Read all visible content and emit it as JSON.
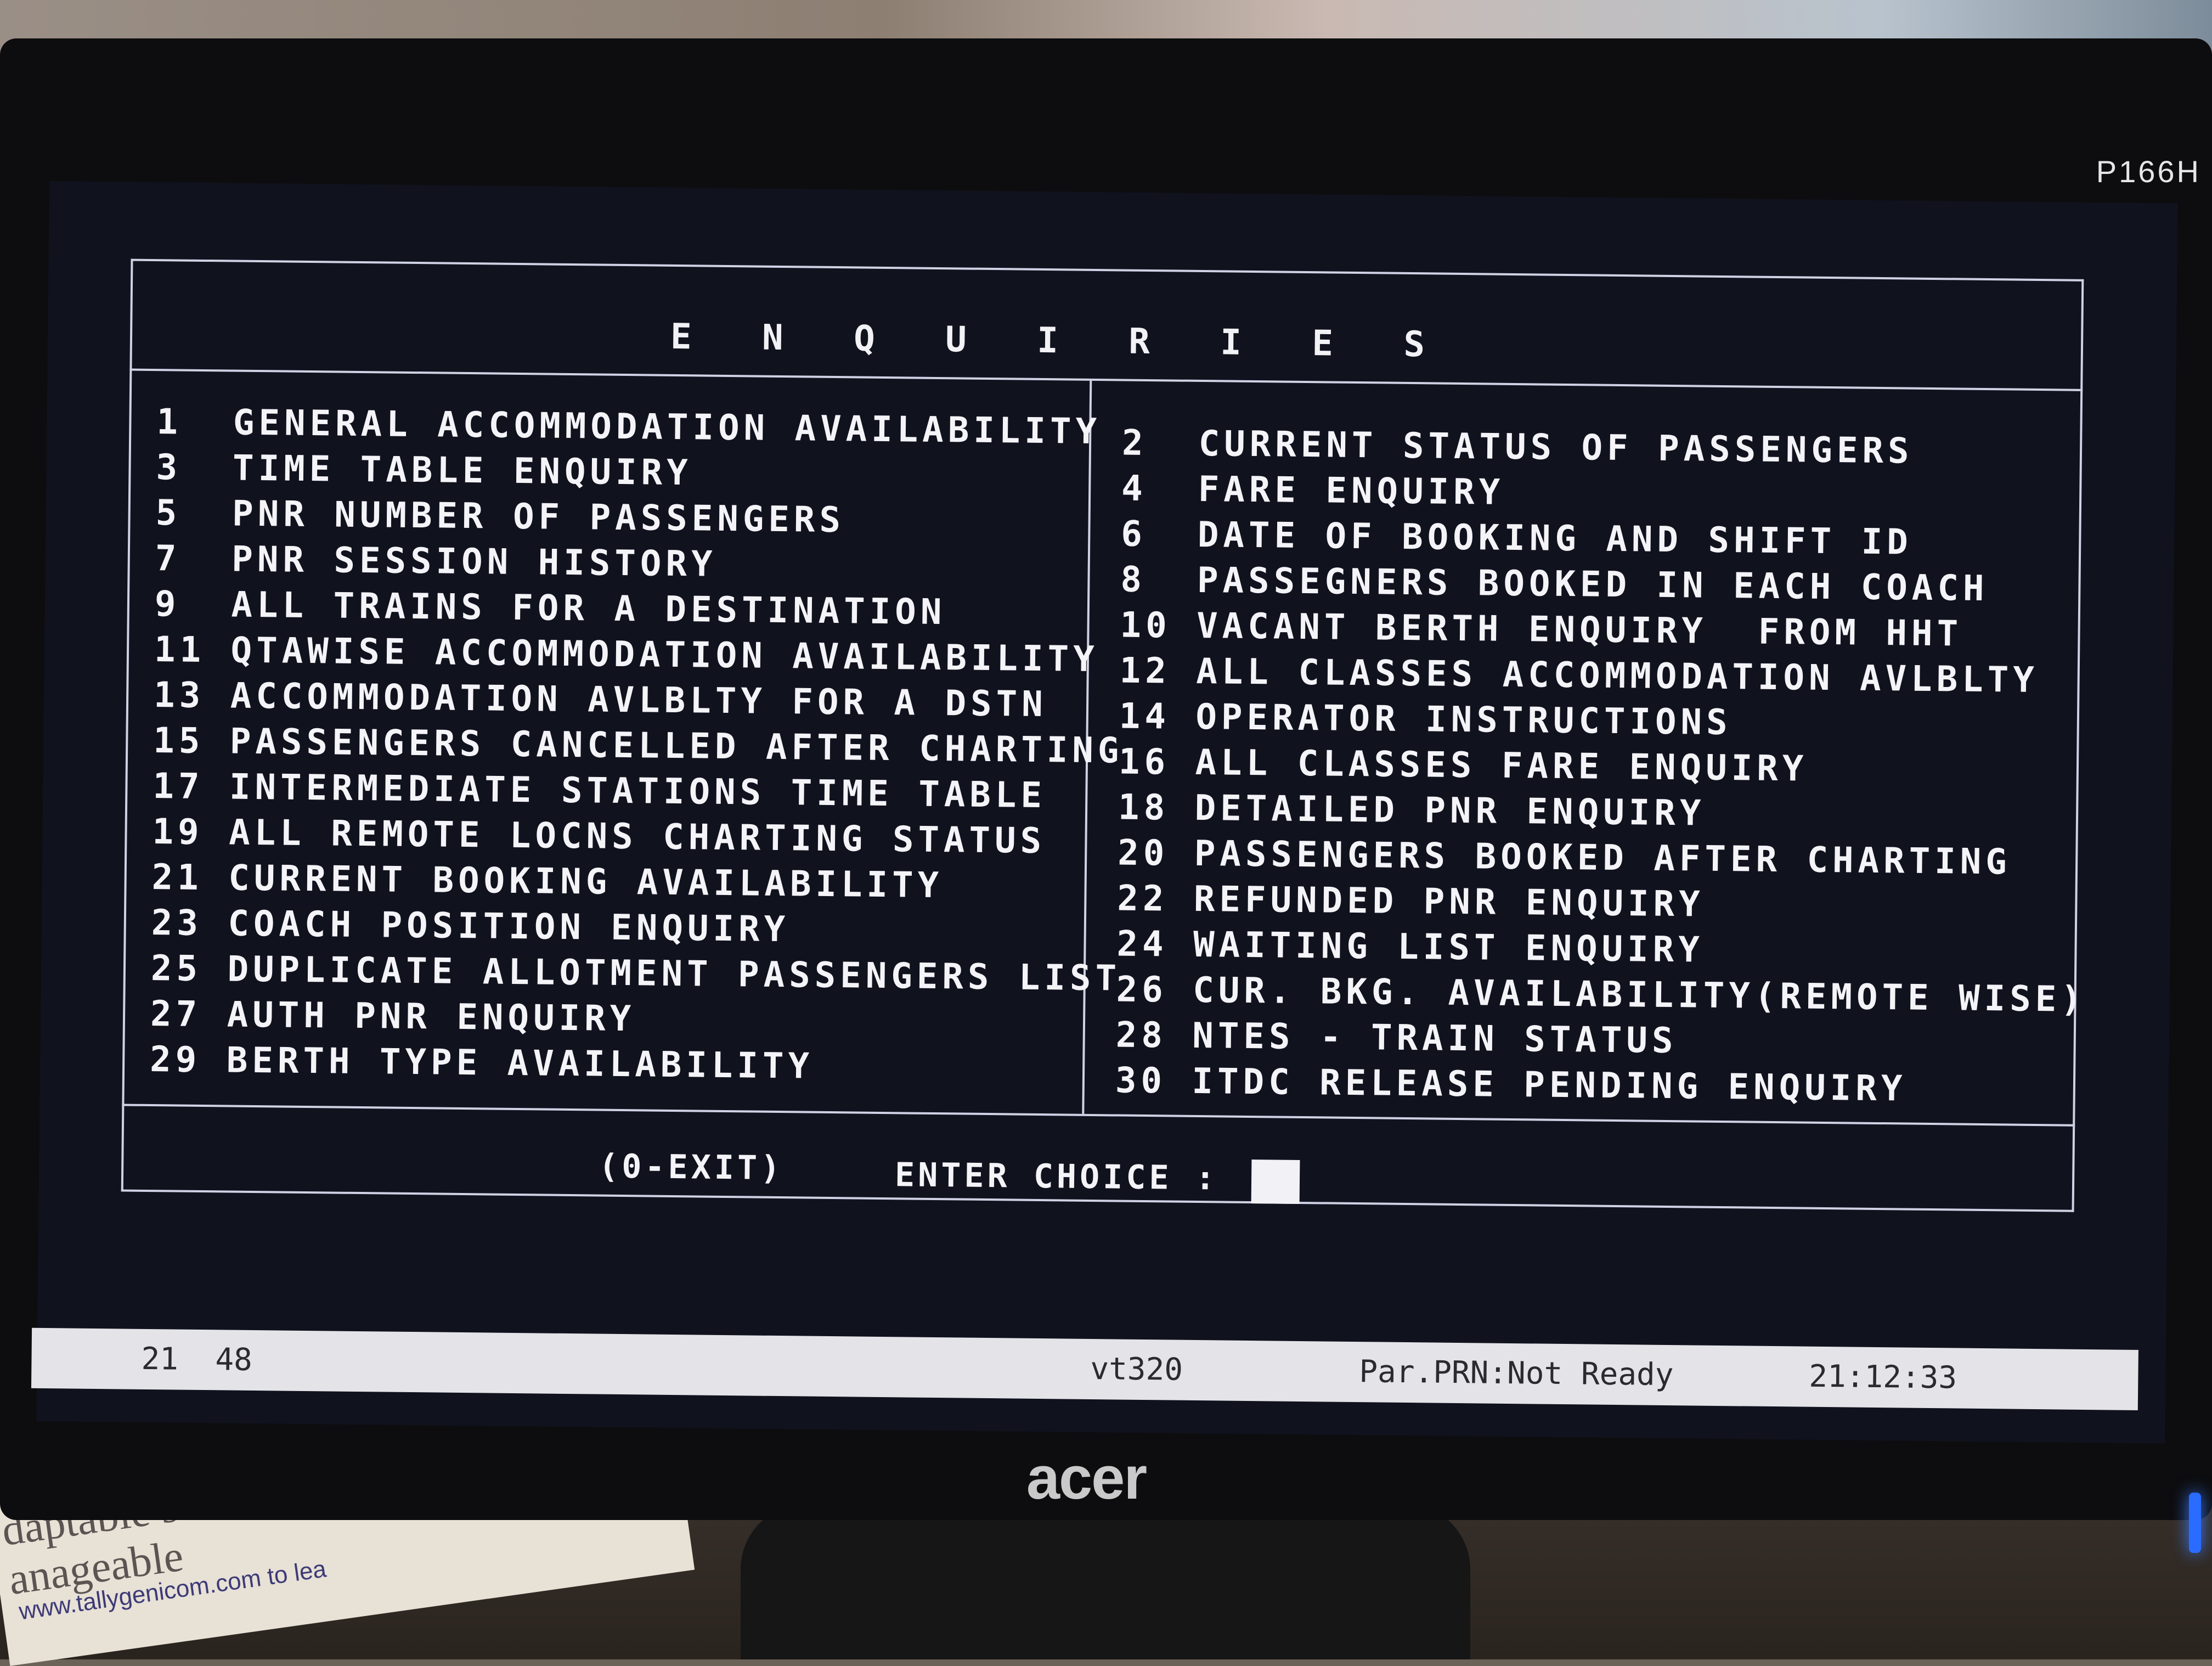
{
  "screen": {
    "title": "E N Q U I R I E S",
    "menu_left": [
      "1  GENERAL ACCOMMODATION AVAILABILITY",
      "3  TIME TABLE ENQUIRY",
      "5  PNR NUMBER OF PASSENGERS",
      "7  PNR SESSION HISTORY",
      "9  ALL TRAINS FOR A DESTINATION",
      "11 QTAWISE ACCOMMODATION AVAILABILITY",
      "13 ACCOMMODATION AVLBLTY FOR A DSTN",
      "15 PASSENGERS CANCELLED AFTER CHARTING",
      "17 INTERMEDIATE STATIONS TIME TABLE",
      "19 ALL REMOTE LOCNS CHARTING STATUS",
      "21 CURRENT BOOKING AVAILABILITY",
      "23 COACH POSITION ENQUIRY",
      "25 DUPLICATE ALLOTMENT PASSENGERS LIST",
      "27 AUTH PNR ENQUIRY",
      "29 BERTH TYPE AVAILABILITY"
    ],
    "menu_right": [
      "2  CURRENT STATUS OF PASSENGERS",
      "4  FARE ENQUIRY",
      "6  DATE OF BOOKING AND SHIFT ID",
      "8  PASSEGNERS BOOKED IN EACH COACH",
      "10 VACANT BERTH ENQUIRY  FROM HHT",
      "12 ALL CLASSES ACCOMMODATION AVLBLTY",
      "14 OPERATOR INSTRUCTIONS",
      "16 ALL CLASSES FARE ENQUIRY",
      "18 DETAILED PNR ENQUIRY",
      "20 PASSENGERS BOOKED AFTER CHARTING",
      "22 REFUNDED PNR ENQUIRY",
      "24 WAITING LIST ENQUIRY",
      "26 CUR. BKG. AVAILABILITY(REMOTE WISE)",
      "28 NTES - TRAIN STATUS",
      "30 ITDC RELEASE PENDING ENQUIRY"
    ],
    "exit_hint": "(0-EXIT)",
    "choice_label": "ENTER CHOICE :",
    "choice_value": ""
  },
  "statusbar": {
    "cursor_pos": "21  48",
    "terminal": "vt320",
    "printer": "Par.PRN:Not Ready",
    "time": "21:12:33"
  },
  "monitor": {
    "model": "P166H",
    "brand": "acer"
  },
  "surroundings": {
    "paper_text": "exible\ndaptable s\nanageable",
    "paper_url": "www.tallygenicom.com to lea"
  },
  "colors": {
    "screen_bg": "#10121e",
    "text": "#f4f4f8",
    "border": "#cfd2e4",
    "statusbar_bg": "#e4e4e8"
  }
}
